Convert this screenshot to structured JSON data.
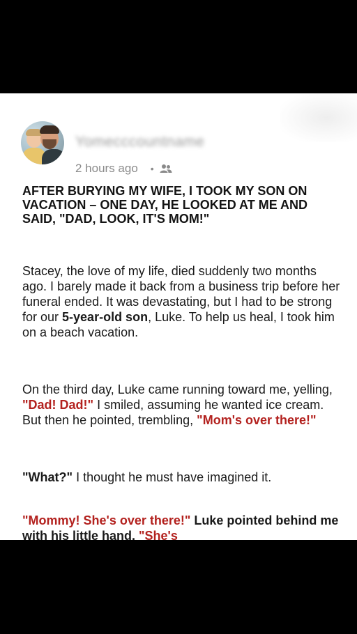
{
  "post": {
    "username": "Yomecccountname",
    "time": "2 hours ago",
    "separator": "•",
    "audience_icon": "friends-icon",
    "headline": "AFTER BURYING MY WIFE, I TOOK MY SON ON VACATION – ONE DAY, HE LOOKED AT ME AND SAID, \"DAD, LOOK, IT'S MOM!\""
  },
  "body": {
    "p1": {
      "text_a": "Stacey, the love of my life, died suddenly two months ago. I barely made it back from a business trip before her funeral ended. It was devastating, but I had to be strong for our ",
      "bold": "5-year-old son",
      "text_b": ", Luke. To help us heal, I took him on a beach vacation."
    },
    "p2": {
      "text_a": "On the third day, Luke came running toward me, yelling, ",
      "quote1": "\"Dad! Dad!\"",
      "text_b": " I smiled, assuming he wanted ice cream. But then he pointed, trembling, ",
      "quote2": "\"Mom's over there!\""
    },
    "p3": {
      "bold": "\"What?\"",
      "text": " I thought he must have imagined it."
    },
    "p4": {
      "quote1": "\"Mommy! She's over there!\"",
      "text": " Luke pointed behind me with his little hand. ",
      "quote2": "\"She's"
    }
  },
  "colors": {
    "accent_red": "#b3211e",
    "text": "#1a1a1a",
    "meta_gray": "#8a8a8a"
  }
}
